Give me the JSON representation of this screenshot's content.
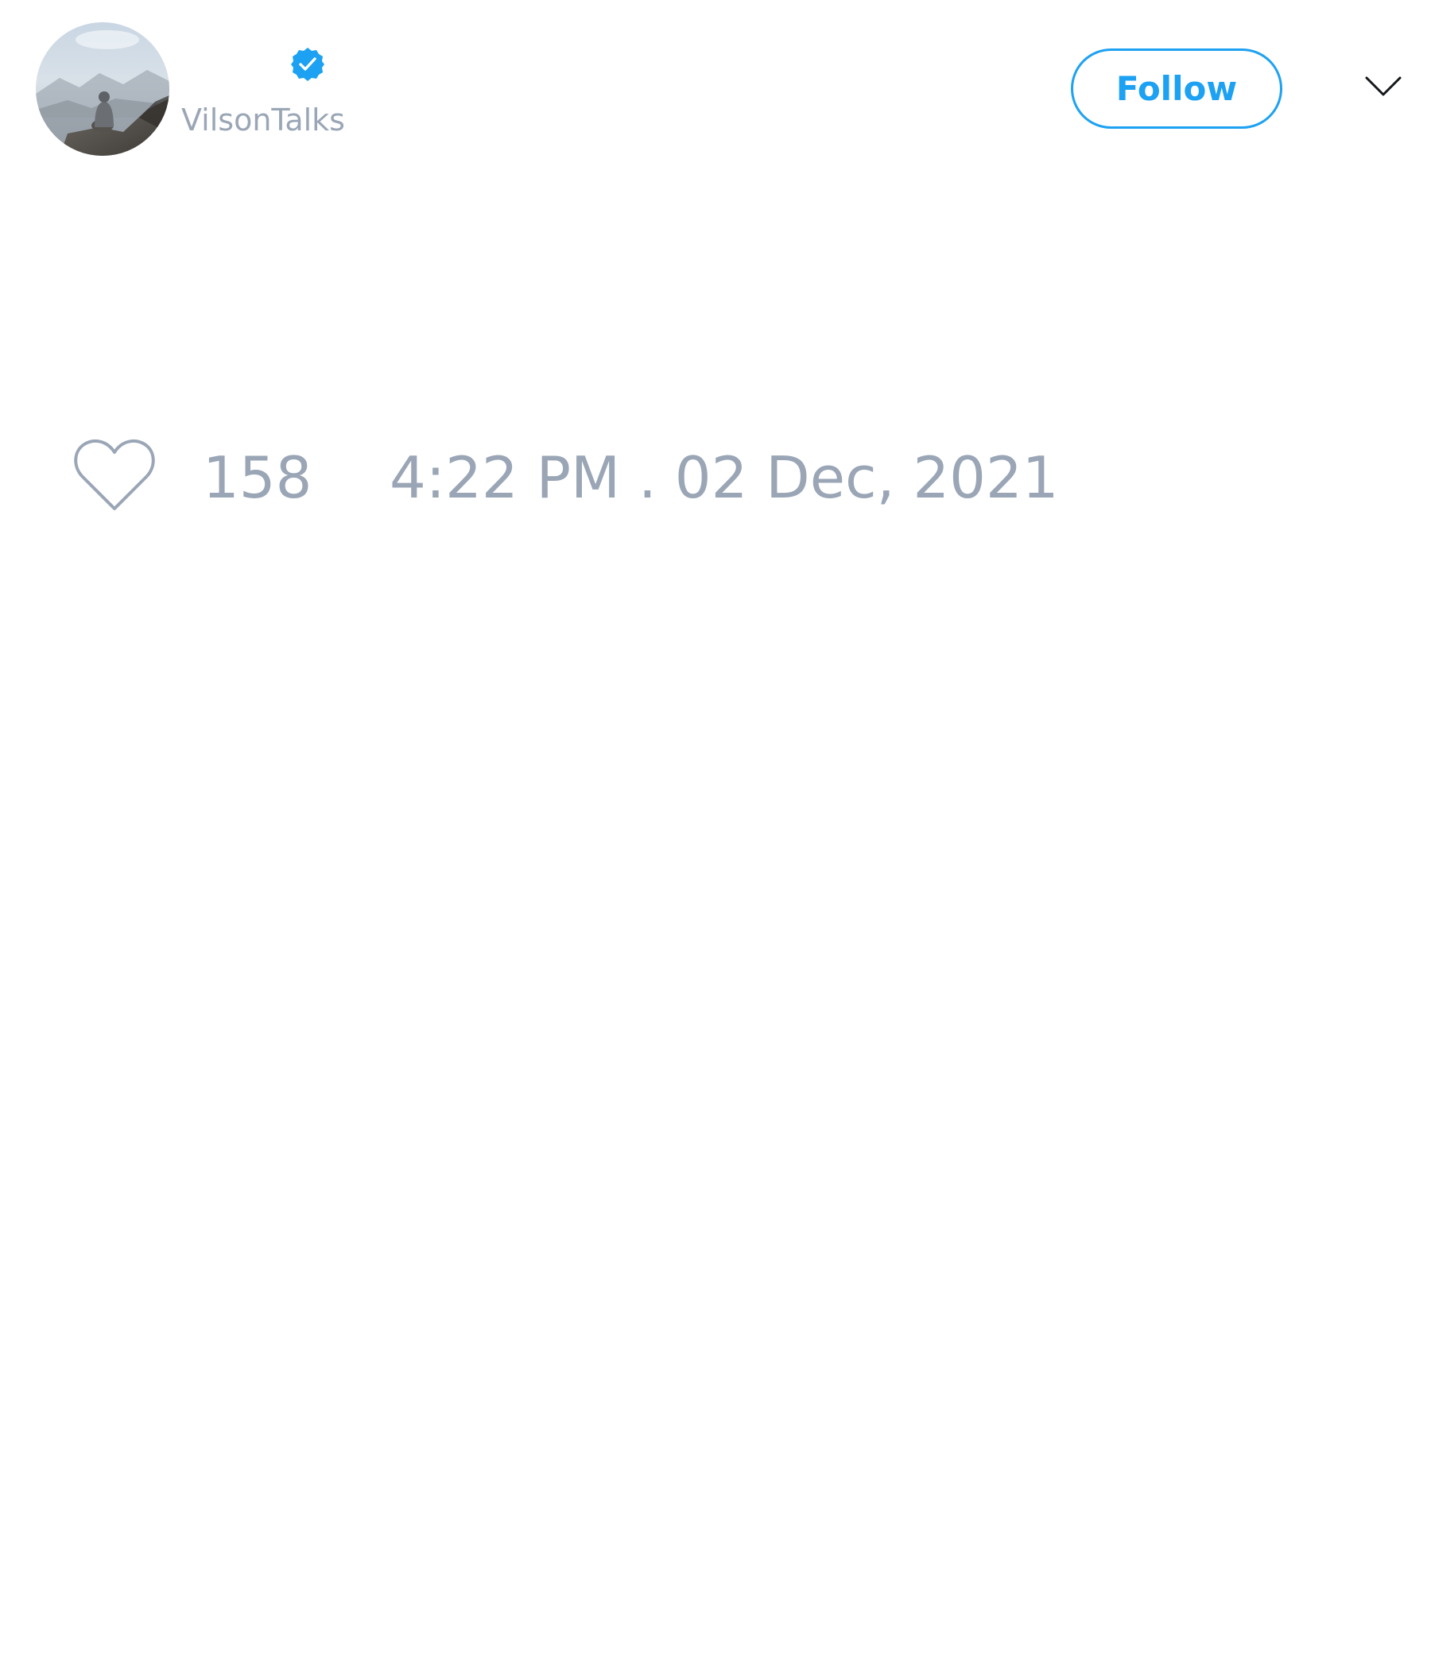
{
  "author": {
    "display_name": "",
    "handle": "VilsonTalks",
    "avatar_icon": "profile-photo-mountain",
    "verified_icon": "verified-badge-icon"
  },
  "actions": {
    "follow_label": "Follow",
    "menu_icon": "chevron-down-icon"
  },
  "tweet": {
    "like_icon": "heart-outline-icon",
    "like_count": "158",
    "timestamp": "4:22 PM . 02 Dec, 2021"
  },
  "colors": {
    "accent": "#1da1f2",
    "muted_text": "#9aa6b6",
    "icon_stroke": "#9aa6b6",
    "menu_icon": "#14171a",
    "background": "#ffffff"
  }
}
